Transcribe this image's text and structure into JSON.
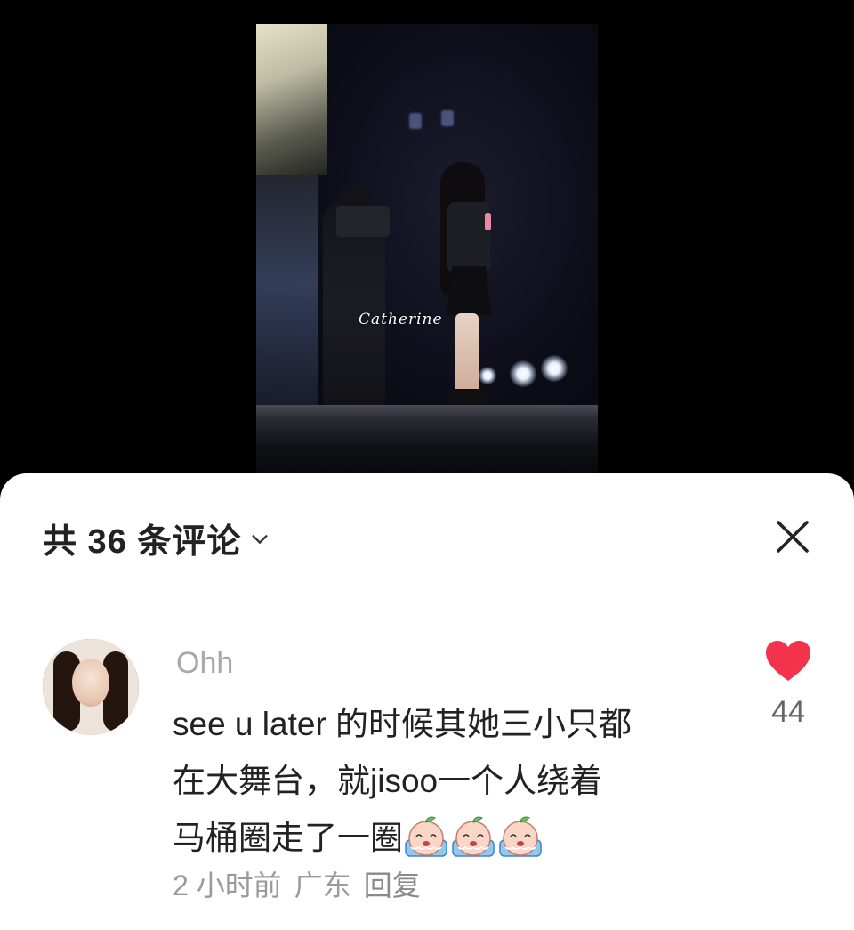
{
  "media": {
    "watermark": "Catherine"
  },
  "sheet": {
    "comment_count_label": "共 36 条评论",
    "icons": {
      "expand": "chevron-down-icon",
      "close": "close-icon"
    }
  },
  "comment": {
    "username": "Ohh",
    "text_lines": [
      "see u later 的时候其她三小只都",
      "在大舞台，就jisoo一个人绕着",
      "马桶圈走了一圈"
    ],
    "emoji_count": 3,
    "emoji_icon": "crying-peach-emoji",
    "time": "2 小时前",
    "location": "广东",
    "reply_label": "回复",
    "likes": "44",
    "like_color": "#f2334b"
  }
}
